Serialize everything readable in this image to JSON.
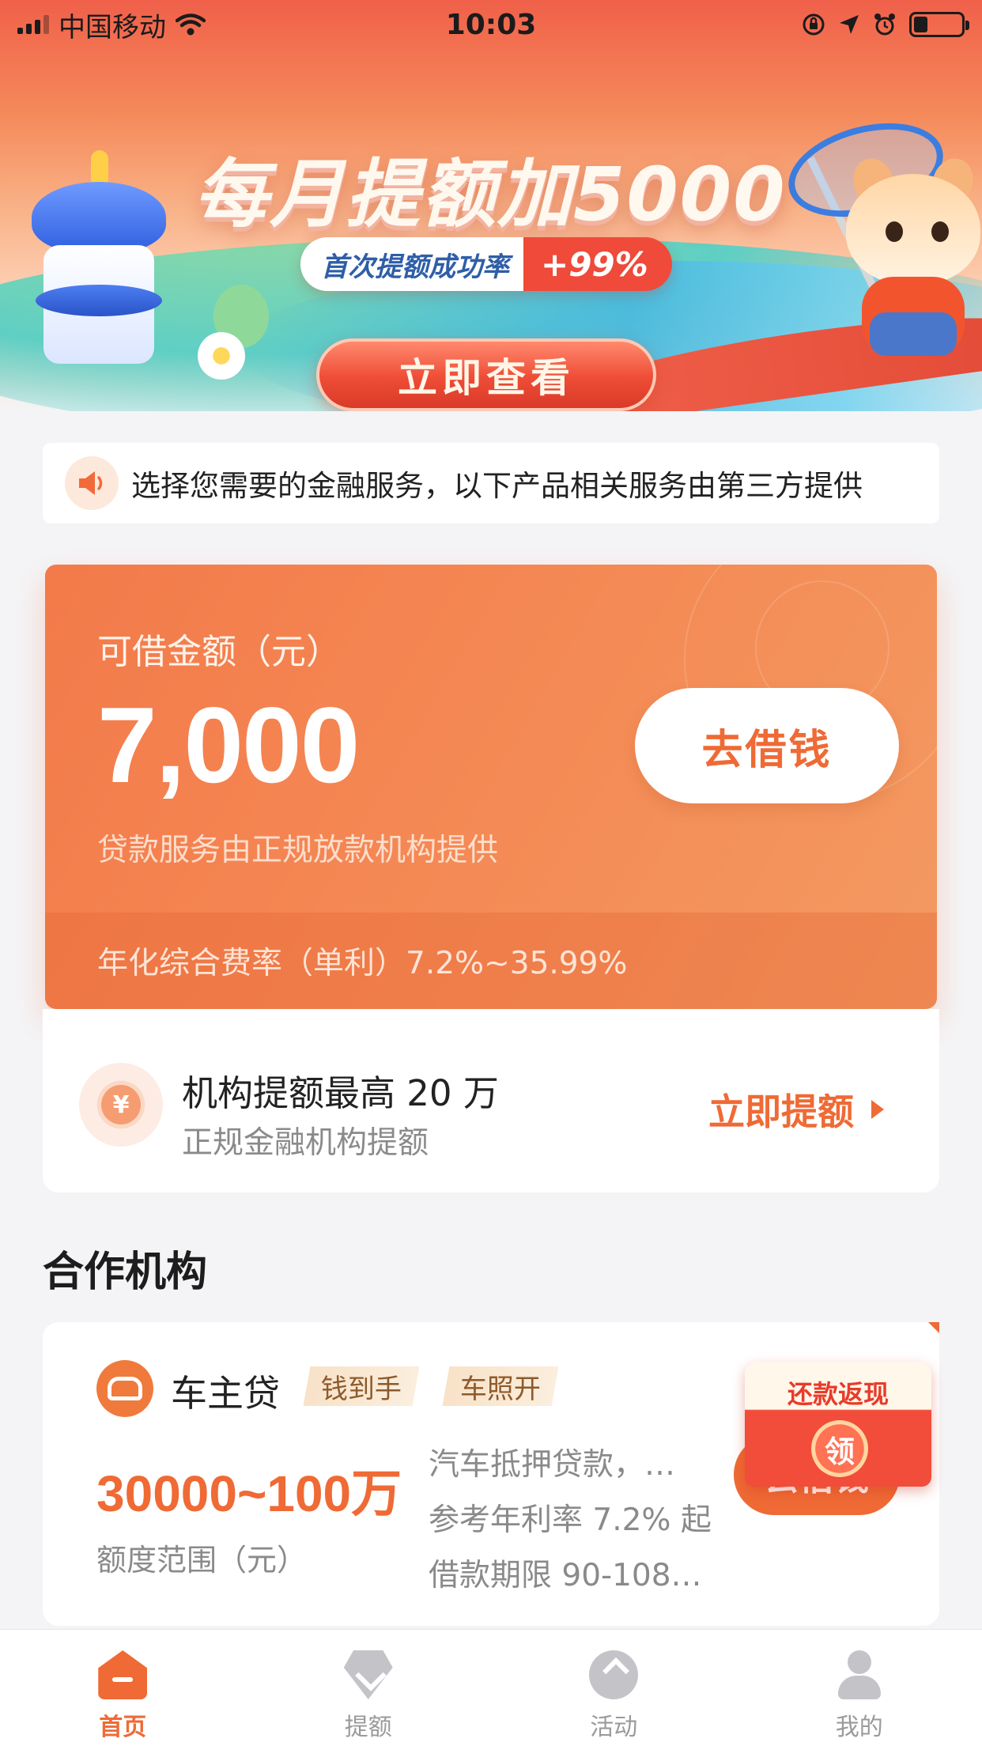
{
  "status_bar": {
    "carrier": "中国移动",
    "time": "10:03"
  },
  "banner": {
    "title": "每月提额加5000",
    "pill_left": "首次提额成功率",
    "pill_right": "+99%",
    "cta": "立即查看"
  },
  "notice": {
    "icon": "speaker-icon",
    "text": "选择您需要的金融服务，以下产品相关服务由第三方提供"
  },
  "loan_card": {
    "label": "可借金额（元）",
    "amount": "7,000",
    "borrow_button": "去借钱",
    "subtitle": "贷款服务由正规放款机构提供",
    "rate": "年化综合费率（单利）7.2%~35.99%"
  },
  "credit_increase": {
    "title": "机构提额最高 20 万",
    "subtitle": "正规金融机构提额",
    "action": "立即提额"
  },
  "section_title": "合作机构",
  "partner": {
    "name": "车主贷",
    "tags": [
      "钱到手",
      "车照开"
    ],
    "range": "30000~100万",
    "range_label": "额度范围（元）",
    "desc": [
      "汽车抵押贷款，…",
      "参考年利率 7.2% 起",
      "借款期限 90-108…"
    ],
    "go_button": "去借钱",
    "redpacket_text": "还款返现",
    "redpacket_coin": "领"
  },
  "tabs": [
    {
      "label": "首页",
      "icon": "home-icon",
      "active": true
    },
    {
      "label": "提额",
      "icon": "credit-gem-icon",
      "active": false
    },
    {
      "label": "活动",
      "icon": "activity-icon",
      "active": false
    },
    {
      "label": "我的",
      "icon": "profile-icon",
      "active": false
    }
  ],
  "colors": {
    "accent": "#ef6a35",
    "banner_top": "#f0604a",
    "card": "#f37a4a"
  }
}
